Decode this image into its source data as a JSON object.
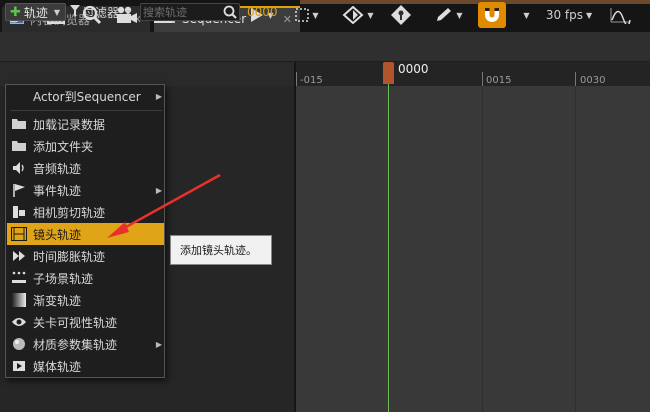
{
  "tabs": [
    {
      "label": "内容浏览器",
      "icon": "content-browser-icon"
    },
    {
      "label": "Sequencer",
      "icon": "sequencer-icon"
    }
  ],
  "toolbar": {
    "fps_label": "30 fps",
    "icons": [
      "world-icon",
      "save-icon",
      "search-icon",
      "camera-icon",
      "clapper-icon",
      "wrench-icon",
      "play-icon",
      "select-box-icon",
      "keyframe-icon",
      "key-icon",
      "pencil-icon",
      "magnet-icon",
      "curve-editor-icon"
    ]
  },
  "track_bar": {
    "add_track_label": "轨迹",
    "filter_label": "过滤器",
    "search_placeholder": "搜索轨迹",
    "time_readout": "0000"
  },
  "timeline": {
    "playhead_label": "0000",
    "tick_labels": [
      "-015",
      "0015",
      "0030"
    ]
  },
  "menu": {
    "items": [
      {
        "label": "Actor到Sequencer",
        "icon": "actor-icon",
        "submenu": true
      },
      {
        "label": "加载记录数据",
        "icon": "folder-icon",
        "submenu": false
      },
      {
        "label": "添加文件夹",
        "icon": "folder-icon",
        "submenu": false
      },
      {
        "label": "音频轨迹",
        "icon": "speaker-icon",
        "submenu": false
      },
      {
        "label": "事件轨迹",
        "icon": "flag-icon",
        "submenu": true
      },
      {
        "label": "相机剪切轨迹",
        "icon": "camera-cut-icon",
        "submenu": false
      },
      {
        "label": "镜头轨迹",
        "icon": "film-strip-icon",
        "submenu": false,
        "selected": true
      },
      {
        "label": "时间膨胀轨迹",
        "icon": "time-dilation-icon",
        "submenu": false
      },
      {
        "label": "子场景轨迹",
        "icon": "subscene-icon",
        "submenu": false
      },
      {
        "label": "渐变轨迹",
        "icon": "fade-icon",
        "submenu": false
      },
      {
        "label": "关卡可视性轨迹",
        "icon": "eye-icon",
        "submenu": false
      },
      {
        "label": "材质参数集轨迹",
        "icon": "material-icon",
        "submenu": true
      },
      {
        "label": "媒体轨迹",
        "icon": "media-icon",
        "submenu": false
      }
    ]
  },
  "tooltip": {
    "text": "添加镜头轨迹。"
  },
  "colors": {
    "accent": "#e0a418",
    "playhead": "#6fbb55",
    "annotation_arrow": "#e8302c"
  }
}
